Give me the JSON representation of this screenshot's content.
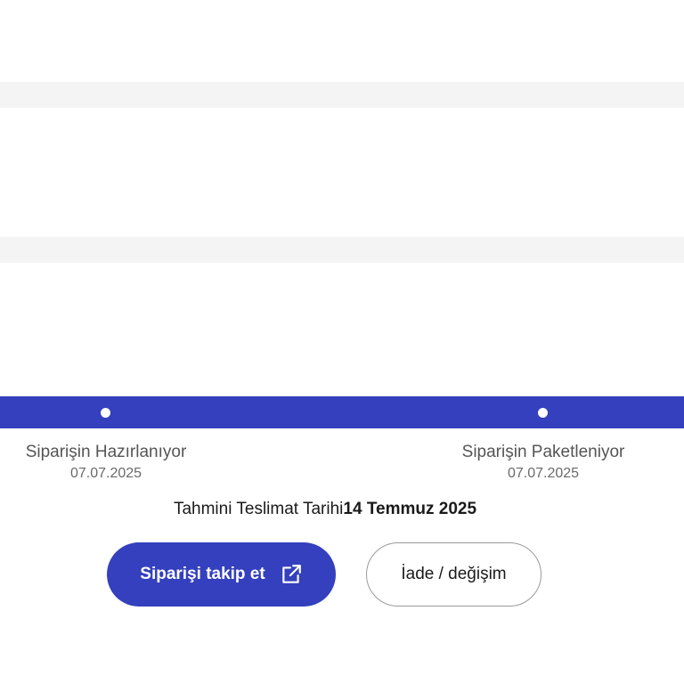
{
  "tracking": {
    "steps": [
      {
        "label": "Siparişin Hazırlanıyor",
        "date": "07.07.2025"
      },
      {
        "label": "Siparişin Paketleniyor",
        "date": "07.07.2025"
      }
    ]
  },
  "delivery": {
    "label": "Tahmini Teslimat Tarihi",
    "date": "14 Temmuz 2025"
  },
  "actions": {
    "track_label": "Siparişi takip et",
    "track_icon": "external-link-icon",
    "return_label": "İade / değişim"
  },
  "colors": {
    "brand": "#3440bd",
    "band": "#f4f4f4"
  }
}
